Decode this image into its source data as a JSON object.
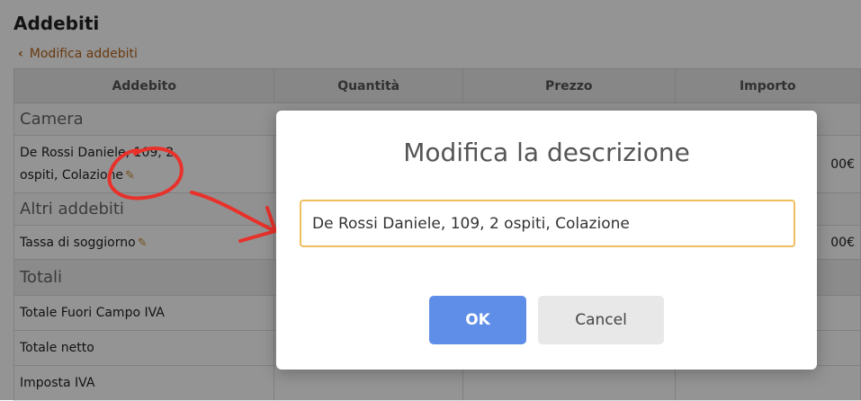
{
  "page": {
    "title": "Addebiti",
    "back_icon": "‹",
    "back_label": "Modifica addebiti"
  },
  "table": {
    "headers": [
      "Addebito",
      "Quantità",
      "Prezzo",
      "Importo"
    ],
    "sections": {
      "camera": "Camera",
      "altri": "Altri addebiti",
      "totali": "Totali"
    },
    "rows": {
      "camera_line1": "De Rossi Daniele, 109, 2",
      "camera_line2": "ospiti, Colazione",
      "camera_amount": "00€",
      "tassa": "Tassa di soggiorno",
      "tassa_amount": "00€",
      "totale_fuori": "Totale Fuori Campo IVA",
      "totale_netto": "Totale netto",
      "imposta": "Imposta IVA"
    },
    "edit_icon": "✎"
  },
  "modal": {
    "title": "Modifica la descrizione",
    "input_value": "De Rossi Daniele, 109, 2 ospiti, Colazione",
    "ok_label": "OK",
    "cancel_label": "Cancel"
  },
  "colors": {
    "accent_link": "#b5651d",
    "input_focus_border": "#efbf5f",
    "ok_button": "#5f8ee8",
    "annotation": "#e8312a"
  },
  "icons": [
    "chevron-left-icon",
    "pencil-icon",
    "red-circle-annotation",
    "red-arrow-annotation"
  ]
}
